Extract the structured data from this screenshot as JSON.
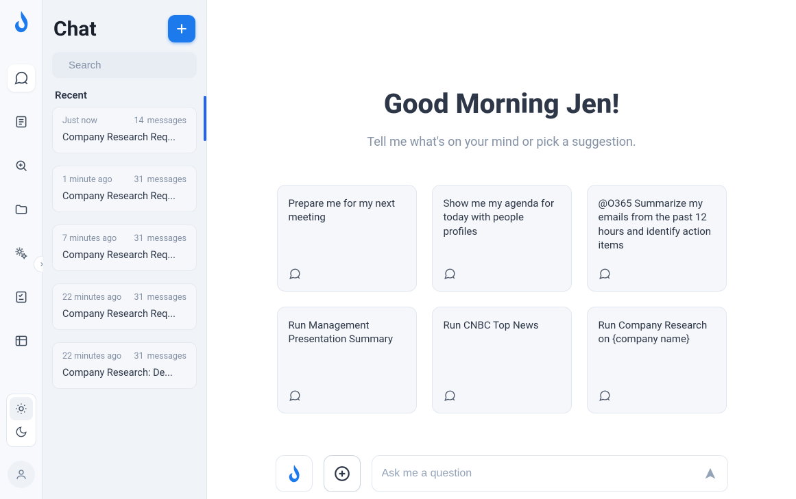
{
  "brand": {
    "name": "flame-logo"
  },
  "rail": {
    "items": [
      {
        "name": "chat-icon",
        "active": true
      },
      {
        "name": "notes-icon",
        "active": false
      },
      {
        "name": "search-zoom-icon",
        "active": false
      },
      {
        "name": "folder-icon",
        "active": false
      },
      {
        "name": "settings-gears-icon",
        "active": false
      },
      {
        "name": "checklist-icon",
        "active": false
      },
      {
        "name": "table-icon",
        "active": false
      }
    ],
    "theme": {
      "light_active": true,
      "dark_active": false
    }
  },
  "recents": {
    "title": "Chat",
    "search_placeholder": "Search",
    "section_label": "Recent",
    "messages_label": "messages",
    "items": [
      {
        "time": "Just now",
        "count": "14",
        "title": "Company Research Req..."
      },
      {
        "time": "1 minute ago",
        "count": "31",
        "title": "Company Research Req..."
      },
      {
        "time": "7 minutes ago",
        "count": "31",
        "title": "Company Research Req..."
      },
      {
        "time": "22 minutes ago",
        "count": "31",
        "title": "Company Research Req..."
      },
      {
        "time": "22 minutes ago",
        "count": "31",
        "title": "Company Research: De..."
      }
    ]
  },
  "main": {
    "greeting": "Good Morning Jen!",
    "subtext": "Tell me what's on your mind or pick a suggestion.",
    "cards": [
      "Prepare me for my next meeting",
      "Show me my agenda for today with people profiles",
      "@O365 Summarize my emails from the past 12 hours and identify action items",
      "Run Management Presentation Summary",
      "Run CNBC Top News",
      "Run Company Research on {company name}"
    ],
    "input_placeholder": "Ask me a question"
  }
}
